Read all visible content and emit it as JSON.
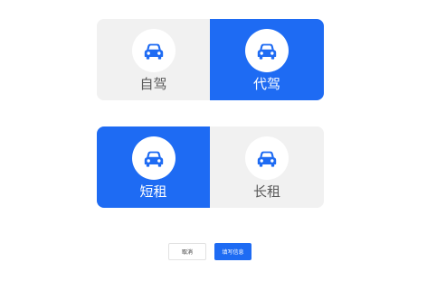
{
  "drive_mode": {
    "options": [
      {
        "label": "自驾",
        "icon": "car-icon",
        "selected": false
      },
      {
        "label": "代驾",
        "icon": "car-icon",
        "selected": true
      }
    ]
  },
  "rental_term": {
    "options": [
      {
        "label": "短租",
        "icon": "car-icon",
        "selected": true
      },
      {
        "label": "长租",
        "icon": "car-icon",
        "selected": false
      }
    ]
  },
  "actions": {
    "cancel_label": "取消",
    "fill_info_label": "填写信息"
  },
  "colors": {
    "accent": "#1e6bf3",
    "inactive_bg": "#f1f1f1",
    "inactive_text": "#5a5a5a",
    "icon_circle": "#ffffff"
  }
}
